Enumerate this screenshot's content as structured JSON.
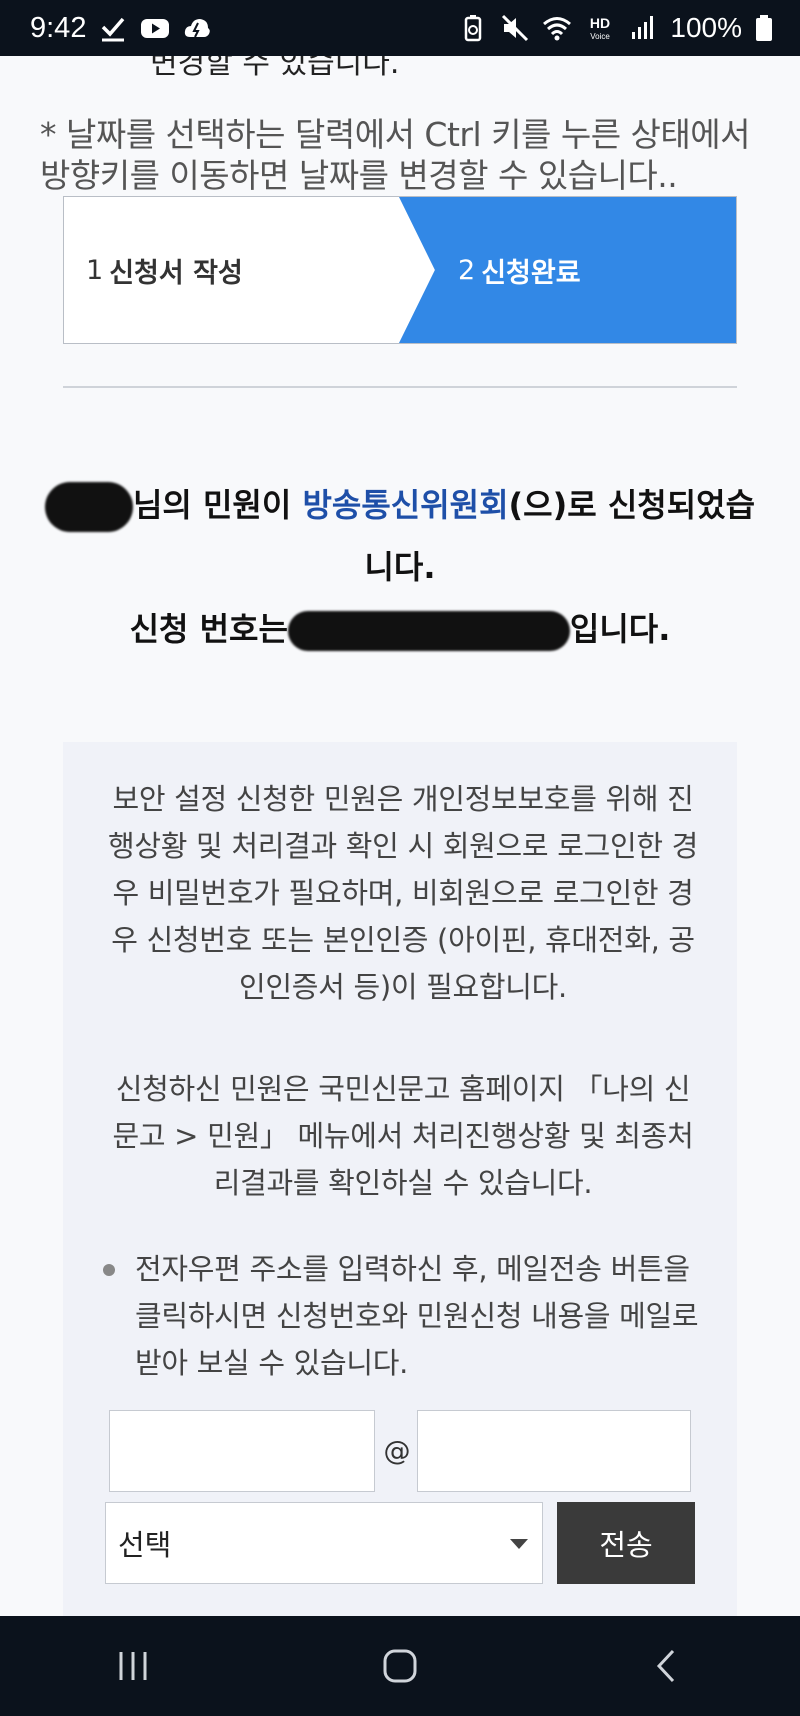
{
  "status_bar": {
    "time": "9:42",
    "battery_text": "100%",
    "icons_left": [
      "check-icon",
      "youtube-icon",
      "weather-icon"
    ],
    "icons_right": [
      "battery-saver-icon",
      "mute-icon",
      "wifi-icon",
      "hd-voice-icon",
      "signal-icon",
      "battery-icon"
    ],
    "hd_voice_label": "HD",
    "hd_voice_sub": "Voice"
  },
  "page": {
    "cut_text": "변경할 수 있습니다.",
    "notice": "* 날짜를 선택하는 달력에서 Ctrl 키를 누른 상태에서 방향키를 이동하면 날짜를 변경할 수 있습니다..",
    "steps": [
      {
        "number": "1",
        "label": "신청서 작성",
        "active": false
      },
      {
        "number": "2",
        "label": "신청완료",
        "active": true
      }
    ],
    "result": {
      "name_suffix": "님의 민원이 ",
      "agency": "방송통신위원회",
      "line1_end": "(으)로 신청되었습니다.",
      "number_prefix": "신청 번호는",
      "number_suffix": "입니다."
    },
    "info": {
      "paragraph1": "보안 설정 신청한 민원은 개인정보보호를 위해 진행상황 및 처리결과 확인 시 회원으로 로그인한 경우 비밀번호가 필요하며, 비회원으로 로그인한 경우 신청번호 또는 본인인증 (아이핀, 휴대전화, 공인인증서 등)이 필요합니다.",
      "paragraph2": "신청하신 민원은 국민신문고 홈페이지 「나의 신문고 > 민원」 메뉴에서 처리진행상황 및 최종처리결과를 확인하실 수 있습니다.",
      "bullet": "전자우편 주소를 입력하신 후, 메일전송 버튼을 클릭하시면 신청번호와 민원신청 내용을 메일로 받아 보실 수 있습니다."
    },
    "email_form": {
      "local_value": "",
      "at": "@",
      "domain_value": "",
      "select_value": "선택",
      "send_label": "전송"
    }
  },
  "colors": {
    "active_step": "#3288e6",
    "agency_link": "#1e4fa8",
    "send_button": "#3a3a3a",
    "system_bars": "#0b121c"
  },
  "nav_bar": {
    "buttons": [
      "recent-apps-icon",
      "home-icon",
      "back-icon"
    ]
  }
}
